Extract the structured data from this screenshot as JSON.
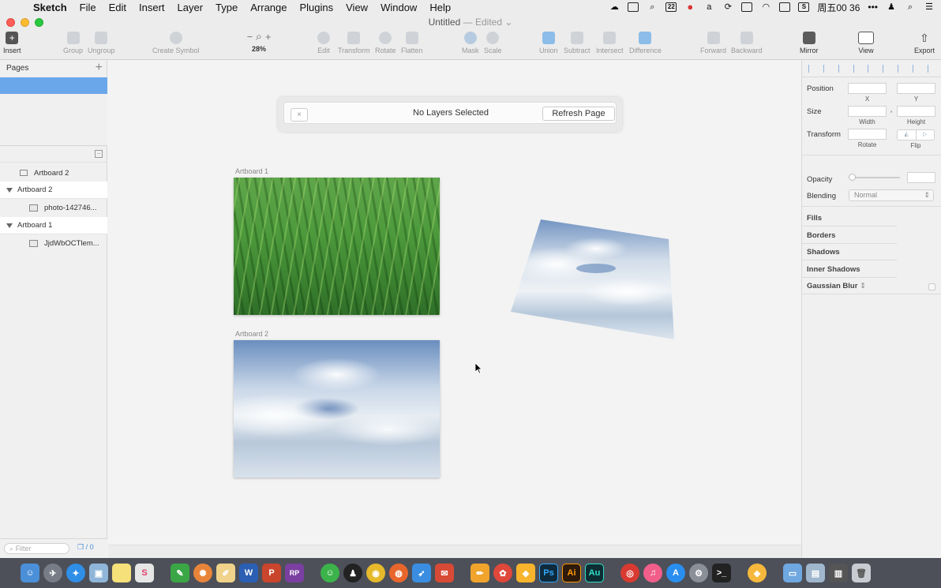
{
  "menubar": {
    "app_name": "Sketch",
    "items": [
      "File",
      "Edit",
      "Insert",
      "Layer",
      "Type",
      "Arrange",
      "Plugins",
      "View",
      "Window",
      "Help"
    ],
    "calendar_badge": "22",
    "clock": "周五00 36",
    "dots": "•••"
  },
  "window": {
    "title": "Untitled",
    "separator": "—",
    "status": "Edited"
  },
  "toolbar": {
    "insert": "Insert",
    "group": "Group",
    "ungroup": "Ungroup",
    "create_symbol": "Create Symbol",
    "zoom_minus": "−",
    "zoom_plus": "+",
    "zoom_level": "28%",
    "edit": "Edit",
    "transform": "Transform",
    "rotate": "Rotate",
    "flatten": "Flatten",
    "mask": "Mask",
    "scale": "Scale",
    "union": "Union",
    "subtract": "Subtract",
    "intersect": "Intersect",
    "difference": "Difference",
    "forward": "Forward",
    "backward": "Backward",
    "mirror": "Mirror",
    "view": "View",
    "export": "Export"
  },
  "pages": {
    "header": "Pages",
    "add": "+"
  },
  "layers": [
    {
      "label": "Artboard 2",
      "kind": "artboard-icon-row"
    },
    {
      "label": "Artboard 2",
      "kind": "artboard"
    },
    {
      "label": "photo-142746...",
      "kind": "image"
    },
    {
      "label": "Artboard 1",
      "kind": "artboard"
    },
    {
      "label": "JjdWbOCTlem...",
      "kind": "image"
    }
  ],
  "filter": {
    "placeholder": "Filter",
    "count": "0"
  },
  "notice": {
    "close": "×",
    "message": "No Layers Selected",
    "refresh": "Refresh Page"
  },
  "canvas": {
    "artboard1_label": "Artboard 1",
    "artboard2_label": "Artboard 2"
  },
  "inspector": {
    "position": "Position",
    "x": "X",
    "y": "Y",
    "size": "Size",
    "width": "Width",
    "height": "Height",
    "transform": "Transform",
    "rotate": "Rotate",
    "flip": "Flip",
    "opacity": "Opacity",
    "blending": "Blending",
    "blending_value": "Normal",
    "fills": "Fills",
    "borders": "Borders",
    "shadows": "Shadows",
    "inner_shadows": "Inner Shadows",
    "gaussian_blur": "Gaussian Blur"
  },
  "dock": {
    "rp": "RP",
    "ps": "Ps",
    "ai": "Ai",
    "au": "Au"
  }
}
